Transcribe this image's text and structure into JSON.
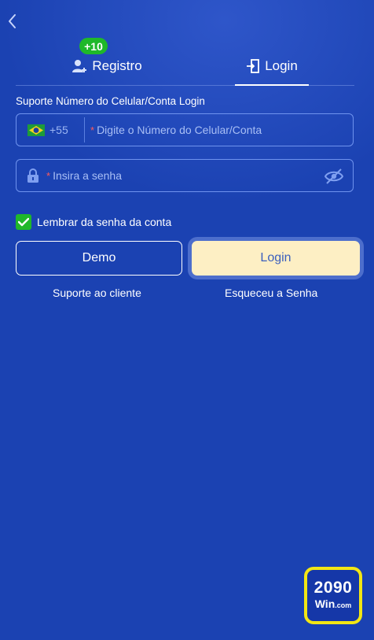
{
  "nav": {
    "back_icon": "chevron-left-icon"
  },
  "tabs": {
    "register": {
      "label": "Registro",
      "badge": "+10",
      "icon": "user-add-icon"
    },
    "login": {
      "label": "Login",
      "icon": "door-enter-icon",
      "active": true
    }
  },
  "form": {
    "section_label": "Suporte Número do Celular/Conta Login",
    "phone": {
      "country_flag": "brazil-flag-icon",
      "country_code": "+55",
      "required_mark": "*",
      "placeholder": "Digite o Número do Celular/Conta",
      "value": ""
    },
    "password": {
      "icon": "lock-icon",
      "required_mark": "*",
      "placeholder": "Insira a senha",
      "value": "",
      "toggle_icon": "eye-off-icon"
    },
    "remember": {
      "label": "Lembrar da senha da conta",
      "checked": true
    }
  },
  "buttons": {
    "demo": "Demo",
    "login": "Login"
  },
  "links": {
    "support": "Suporte ao cliente",
    "forgot": "Esqueceu a Senha"
  },
  "logo": {
    "number": "2090",
    "text": "Win",
    "suffix": ".com"
  },
  "colors": {
    "background": "#1b42b2",
    "badge": "#1fb82a",
    "checkbox": "#1fb82a",
    "login_button": "#fdefc4",
    "logo_border": "#f2e614",
    "required": "#ff5a5a"
  }
}
